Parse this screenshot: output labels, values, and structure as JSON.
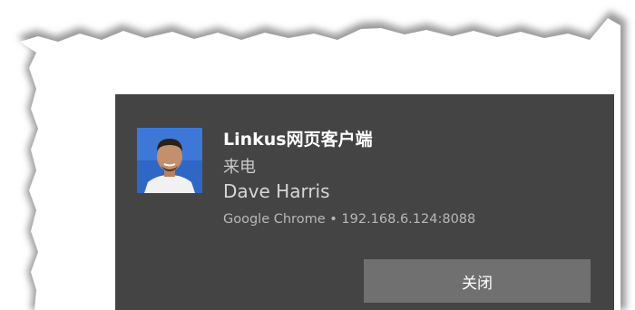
{
  "notification": {
    "app_name": "Linkus网页客户端",
    "status": "来电",
    "caller_name": "Dave Harris",
    "attribution": "Google Chrome • 192.168.6.124:8088",
    "dismiss_label": "关闭"
  },
  "colors": {
    "toast_background": "#444444",
    "button_background": "#707070",
    "avatar_background": "#2f67c6"
  }
}
